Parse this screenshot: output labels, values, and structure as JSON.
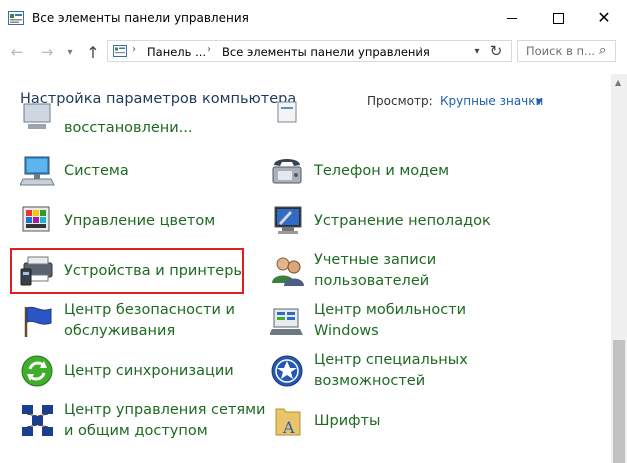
{
  "window": {
    "title": "Все элементы панели управления",
    "min_label": "—",
    "close_label": "✕"
  },
  "nav": {
    "back_icon": "←",
    "forward_icon": "→",
    "recent_icon": "▾",
    "up_icon": "↑",
    "breadcrumb": [
      "Панель ...",
      "Все элементы панели управления"
    ],
    "sep": "›",
    "dropdown_icon": "▾",
    "refresh_icon": "↻",
    "search_placeholder": "Поиск в п...",
    "search_icon": "⌕"
  },
  "content": {
    "heading": "Настройка параметров компьютера",
    "view_label": "Просмотр:",
    "view_value": "Крупные значки",
    "view_arrow": "▼"
  },
  "items_left": [
    {
      "line1": "восстановлени...",
      "line2": "",
      "icon": "recovery-icon"
    },
    {
      "line1": "Система",
      "line2": "",
      "icon": "system-icon"
    },
    {
      "line1": "Управление цветом",
      "line2": "",
      "icon": "color-management-icon"
    },
    {
      "line1": "Устройства и принтеры",
      "line2": "",
      "icon": "devices-printers-icon"
    },
    {
      "line1": "Центр безопасности и",
      "line2": "обслуживания",
      "icon": "security-maintenance-icon"
    },
    {
      "line1": "Центр синхронизации",
      "line2": "",
      "icon": "sync-center-icon"
    },
    {
      "line1": "Центр управления сетями",
      "line2": "и общим доступом",
      "icon": "network-sharing-icon"
    }
  ],
  "items_right": [
    {
      "line1": "Телефон и модем",
      "line2": "",
      "icon": "phone-modem-icon"
    },
    {
      "line1": "Устранение неполадок",
      "line2": "",
      "icon": "troubleshooting-icon"
    },
    {
      "line1": "Учетные записи",
      "line2": "пользователей",
      "icon": "user-accounts-icon"
    },
    {
      "line1": "Центр мобильности",
      "line2": "Windows",
      "icon": "mobility-center-icon"
    },
    {
      "line1": "Центр специальных",
      "line2": "возможностей",
      "icon": "ease-of-access-icon"
    },
    {
      "line1": "Шрифты",
      "line2": "",
      "icon": "fonts-icon"
    }
  ],
  "colors": {
    "link_green": "#1e6a21",
    "heading_blue": "#1e395b",
    "view_blue": "#1a5fb4",
    "highlight_red": "#e02020"
  }
}
